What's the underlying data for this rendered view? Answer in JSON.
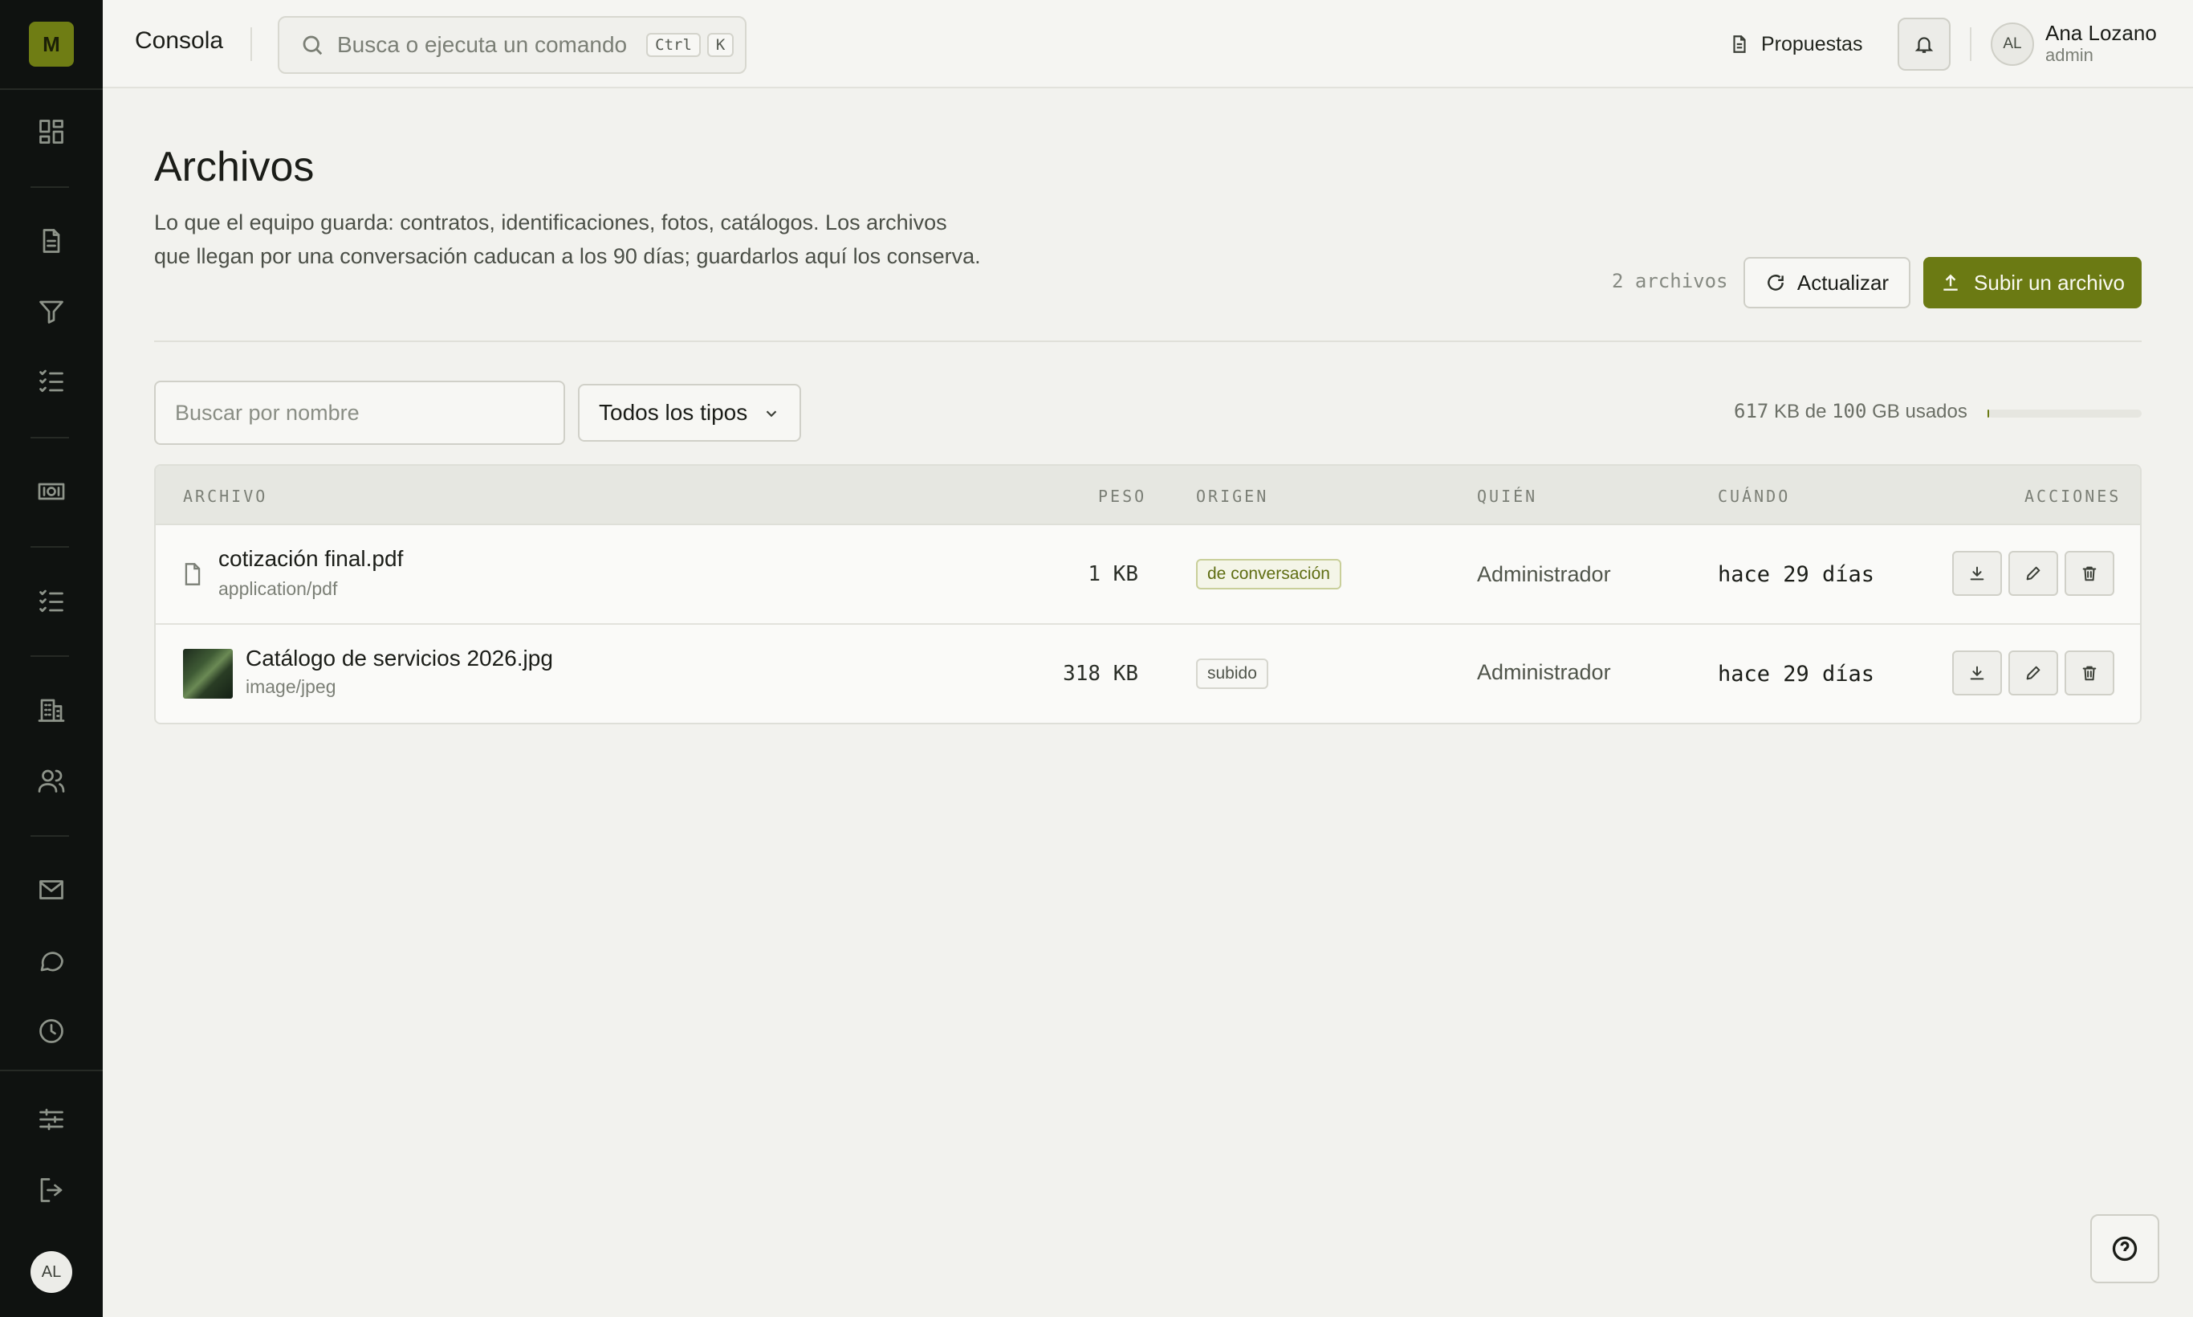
{
  "sidebar": {
    "logo_letter": "M",
    "avatar_initials": "AL",
    "icons": [
      "dashboard-icon",
      "document-icon",
      "filter-icon",
      "checklist-icon",
      "money-icon",
      "tasks-icon",
      "building-icon",
      "users-icon",
      "mail-icon",
      "chat-icon",
      "clock-icon",
      "sliders-icon",
      "logout-icon"
    ]
  },
  "topbar": {
    "title": "Consola",
    "search_placeholder": "Busca o ejecuta un comando",
    "shortcut_1": "Ctrl",
    "shortcut_2": "K",
    "proposals_label": "Propuestas",
    "user_initials": "AL",
    "user_name": "Ana Lozano",
    "user_role": "admin"
  },
  "page": {
    "title": "Archivos",
    "description": "Lo que el equipo guarda: contratos, identificaciones, fotos, catálogos. Los archivos que llegan por una conversación caducan a los 90 días; guardarlos aquí los conserva.",
    "file_count": "2 archivos",
    "refresh_label": "Actualizar",
    "upload_label": "Subir un archivo",
    "name_filter_placeholder": "Buscar por nombre",
    "type_filter_value": "Todos los tipos",
    "usage_used": "617",
    "usage_used_unit": "KB de",
    "usage_total": "100",
    "usage_total_unit": "GB usados",
    "usage_fraction": 6e-06
  },
  "table": {
    "headers": {
      "file": "ARCHIVO",
      "size": "PESO",
      "origin": "ORIGEN",
      "who": "QUIÉN",
      "when": "CUÁNDO",
      "actions": "ACCIONES"
    },
    "rows": [
      {
        "name": "cotización final.pdf",
        "mime": "application/pdf",
        "size": "1 KB",
        "origin": "de conversación",
        "who": "Administrador",
        "when": "hace 29 días"
      },
      {
        "name": "Catálogo de servicios 2026.jpg",
        "mime": "image/jpeg",
        "size": "318 KB",
        "origin": "subido",
        "who": "Administrador",
        "when": "hace 29 días"
      }
    ]
  },
  "colors": {
    "accent": "#6b7a13",
    "sidebar_bg": "#0f1210",
    "page_bg": "#f2f2ee"
  }
}
